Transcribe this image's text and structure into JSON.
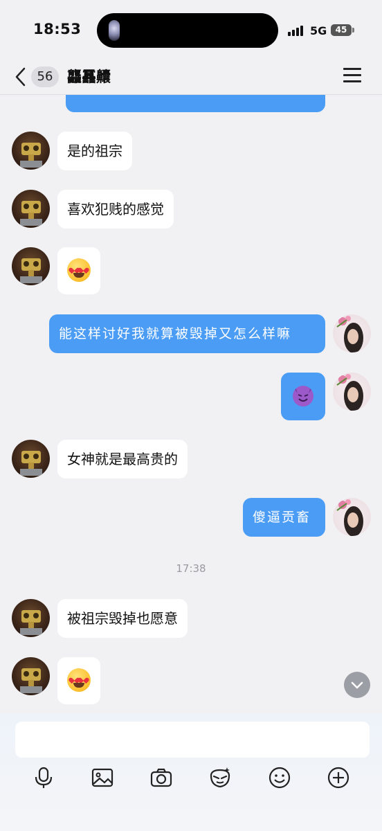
{
  "status_bar": {
    "time": "18:53",
    "network": "5G",
    "battery": "45"
  },
  "header": {
    "unread_count": "56",
    "title": "龘靐齉"
  },
  "messages": [
    {
      "from": "them",
      "text": "是的祖宗"
    },
    {
      "from": "them",
      "text": "喜欢犯贱的感觉"
    },
    {
      "from": "them",
      "emoji": "heart-eyes-emoji"
    },
    {
      "from": "me",
      "text": "能这样讨好我就算被毁掉又怎么样嘛"
    },
    {
      "from": "me",
      "emoji": "smiling-devil-emoji"
    },
    {
      "from": "them",
      "text": "女神就是最高贵的"
    },
    {
      "from": "me",
      "text": "傻逼贡畜"
    },
    {
      "timestamp": "17:38"
    },
    {
      "from": "them",
      "text": "被祖宗毁掉也愿意"
    },
    {
      "from": "them",
      "emoji": "heart-eyes-emoji"
    }
  ],
  "composer": {
    "placeholder": ""
  },
  "toolbar": [
    "microphone-icon",
    "image-icon",
    "camera-icon",
    "sticker-icon",
    "emoji-icon",
    "plus-icon"
  ],
  "colors": {
    "my_bubble": "#4b9cf5",
    "their_bubble": "#ffffff",
    "background": "#f1f1f3"
  }
}
